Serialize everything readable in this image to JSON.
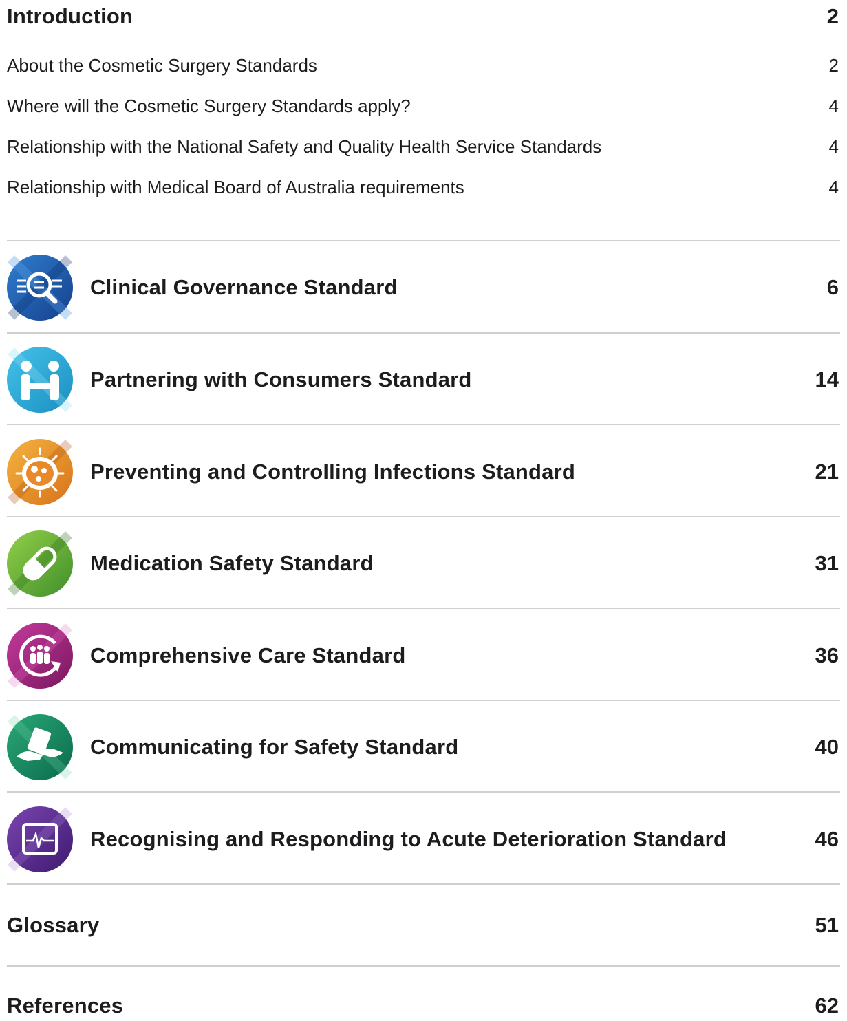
{
  "introduction": {
    "title": "Introduction",
    "page": "2",
    "subsections": [
      {
        "label": "About the Cosmetic Surgery Standards",
        "page": "2"
      },
      {
        "label": "Where will the Cosmetic Surgery Standards apply?",
        "page": "4"
      },
      {
        "label": "Relationship with the National Safety and Quality Health Service Standards",
        "page": "4"
      },
      {
        "label": "Relationship with Medical Board of Australia requirements",
        "page": "4"
      }
    ]
  },
  "standards": [
    {
      "label": "Clinical Governance Standard",
      "page": "6",
      "icon": "magnifier-icon",
      "color": "#1f5fb0"
    },
    {
      "label": "Partnering with Consumers Standard",
      "page": "14",
      "icon": "people-icon",
      "color": "#27a9d6"
    },
    {
      "label": "Preventing and Controlling Infections Standard",
      "page": "21",
      "icon": "microbe-icon",
      "color": "#e6962a"
    },
    {
      "label": "Medication Safety Standard",
      "page": "31",
      "icon": "pill-icon",
      "color": "#6fb53a"
    },
    {
      "label": "Comprehensive Care Standard",
      "page": "36",
      "icon": "care-cycle-icon",
      "color": "#a3247f"
    },
    {
      "label": "Communicating for Safety Standard",
      "page": "40",
      "icon": "handover-icon",
      "color": "#14845f"
    },
    {
      "label": "Recognising and Responding to Acute Deterioration Standard",
      "page": "46",
      "icon": "monitor-icon",
      "color": "#5b2c8f"
    }
  ],
  "glossary": {
    "label": "Glossary",
    "page": "51"
  },
  "references": {
    "label": "References",
    "page": "62"
  }
}
